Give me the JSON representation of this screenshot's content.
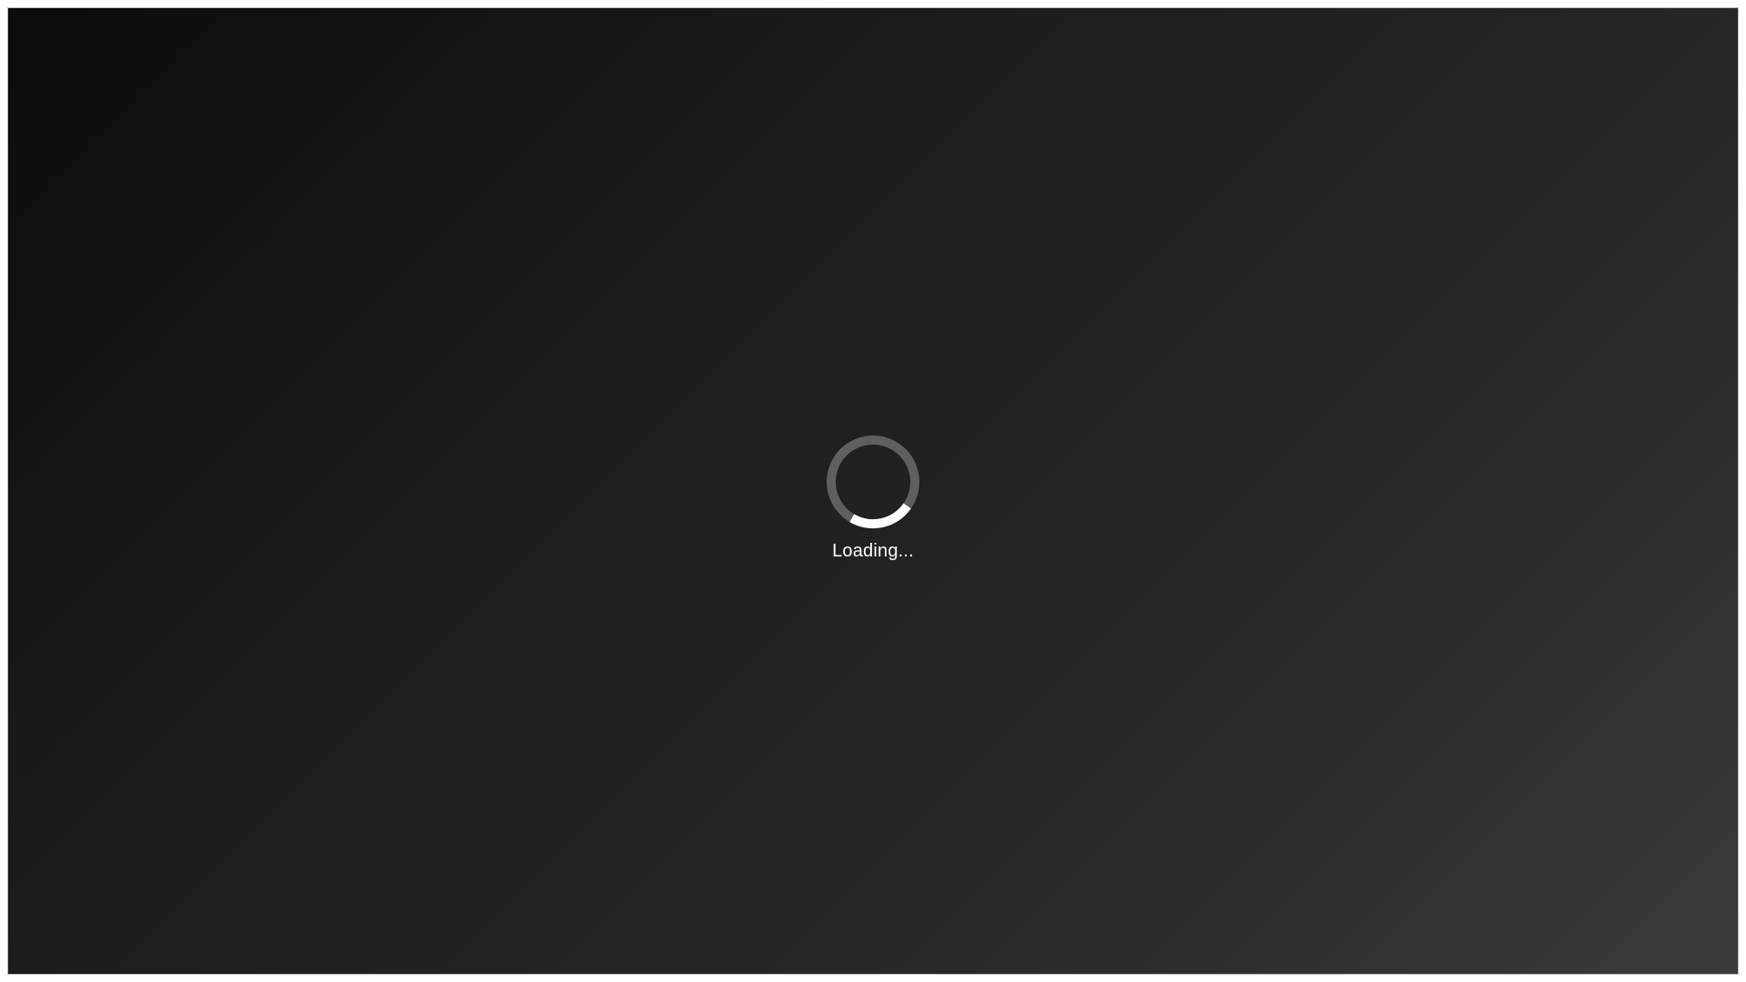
{
  "loading_screen": {
    "status_text": "Loading...",
    "spinner": {
      "icon": "loading-spinner-icon",
      "track_color": "#5f5f5f",
      "indicator_color": "#ffffff"
    },
    "background_colors": [
      "#0b0b0c",
      "#262627",
      "#3a3a3b"
    ]
  }
}
